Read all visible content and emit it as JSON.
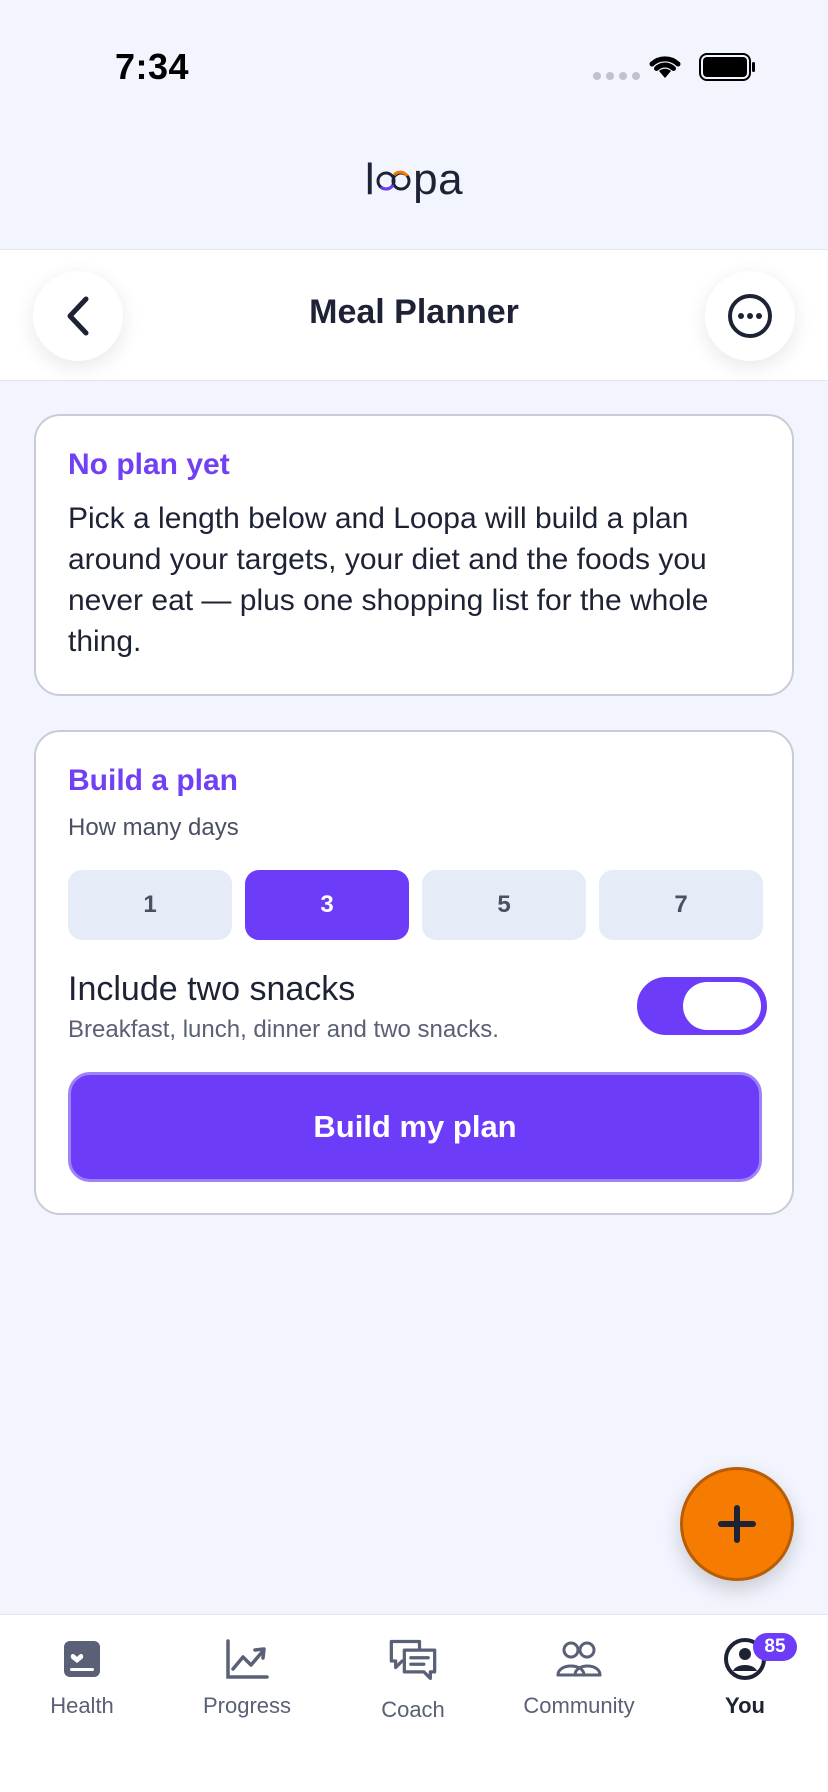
{
  "status_bar": {
    "time": "7:34"
  },
  "brand": {
    "name_left": "l",
    "name_right": "pa"
  },
  "header": {
    "title": "Meal Planner"
  },
  "intro_card": {
    "heading": "No plan yet",
    "body": "Pick a length below and Loopa will build a plan around your targets, your diet and the foods you never eat — plus one shopping list for the whole thing."
  },
  "build_card": {
    "heading": "Build a plan",
    "days_label": "How many days",
    "day_options": [
      "1",
      "3",
      "5",
      "7"
    ],
    "selected_day": "3",
    "snacks_title": "Include two snacks",
    "snacks_subtitle": "Breakfast, lunch, dinner and two snacks.",
    "snacks_enabled": true,
    "build_button": "Build my plan"
  },
  "tab_bar": {
    "tabs": [
      {
        "label": "Health",
        "icon": "health-icon"
      },
      {
        "label": "Progress",
        "icon": "progress-chart-icon"
      },
      {
        "label": "Coach",
        "icon": "chat-bubbles-icon"
      },
      {
        "label": "Community",
        "icon": "people-icon"
      },
      {
        "label": "You",
        "icon": "profile-icon"
      }
    ],
    "active": "You",
    "you_badge": "85"
  },
  "colors": {
    "accent": "#6C3CF8",
    "heading_purple": "#7140F5",
    "fab_orange": "#F57C00",
    "background": "#F3F5FE"
  }
}
